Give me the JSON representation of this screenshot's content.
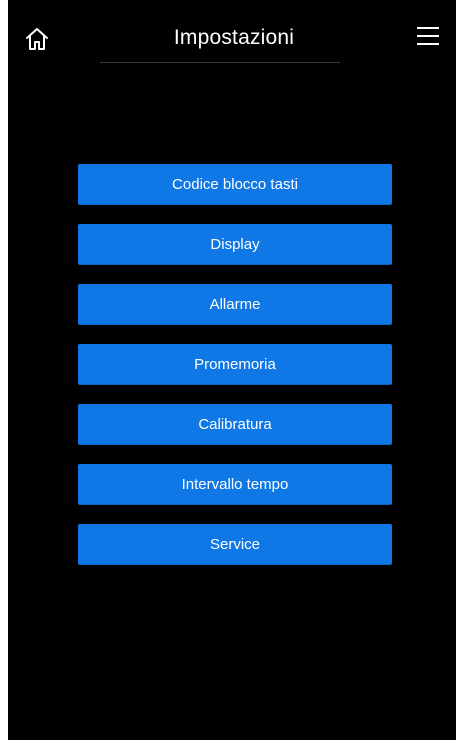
{
  "header": {
    "title": "Impostazioni",
    "home_icon": "home-icon",
    "menu_icon": "hamburger-menu-icon"
  },
  "menu": {
    "items": [
      {
        "label": "Codice blocco tasti"
      },
      {
        "label": "Display"
      },
      {
        "label": "Allarme"
      },
      {
        "label": "Promemoria"
      },
      {
        "label": "Calibratura"
      },
      {
        "label": "Intervallo tempo"
      },
      {
        "label": "Service"
      }
    ]
  },
  "colors": {
    "background": "#000000",
    "button": "#0f78e6",
    "text": "#ffffff"
  }
}
